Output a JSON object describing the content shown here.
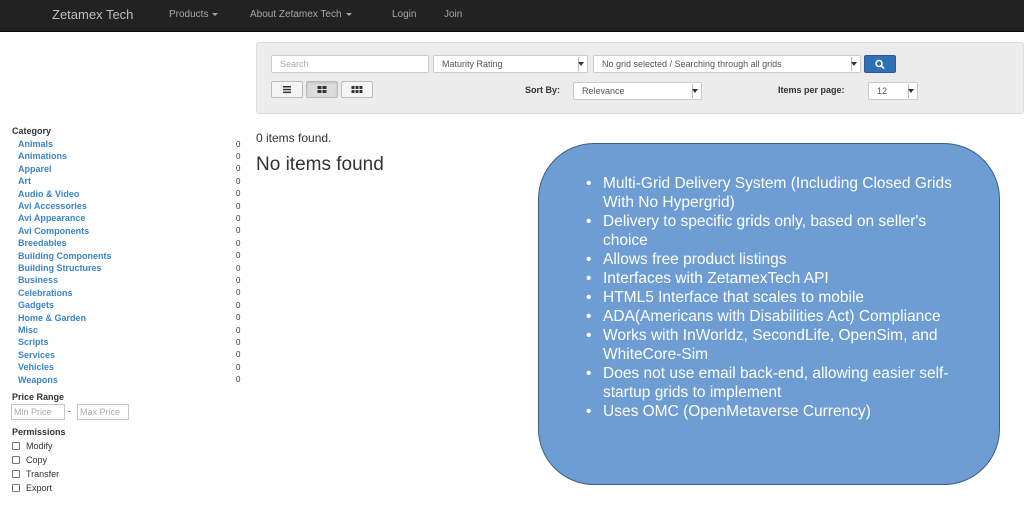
{
  "navbar": {
    "brand": "Zetamex Tech",
    "items": [
      {
        "label": "Products",
        "dropdown": true
      },
      {
        "label": "About Zetamex Tech",
        "dropdown": true
      },
      {
        "label": "Login",
        "dropdown": false
      },
      {
        "label": "Join",
        "dropdown": false
      }
    ]
  },
  "search": {
    "placeholder": "Search",
    "maturity_selected": "Maturity Rating",
    "grid_selected": "No grid selected / Searching through all grids",
    "sort_label": "Sort By:",
    "sort_selected": "Relevance",
    "per_page_label": "Items per page:",
    "per_page_selected": "12"
  },
  "sidebar": {
    "category_heading": "Category",
    "categories": [
      {
        "label": "Animals",
        "count": "0"
      },
      {
        "label": "Animations",
        "count": "0"
      },
      {
        "label": "Apparel",
        "count": "0"
      },
      {
        "label": "Art",
        "count": "0"
      },
      {
        "label": "Audio & Video",
        "count": "0"
      },
      {
        "label": "Avi Accessories",
        "count": "0"
      },
      {
        "label": "Avi Appearance",
        "count": "0"
      },
      {
        "label": "Avi Components",
        "count": "0"
      },
      {
        "label": "Breedables",
        "count": "0"
      },
      {
        "label": "Building Components",
        "count": "0"
      },
      {
        "label": "Building Structures",
        "count": "0"
      },
      {
        "label": "Business",
        "count": "0"
      },
      {
        "label": "Celebrations",
        "count": "0"
      },
      {
        "label": "Gadgets",
        "count": "0"
      },
      {
        "label": "Home & Garden",
        "count": "0"
      },
      {
        "label": "Misc",
        "count": "0"
      },
      {
        "label": "Scripts",
        "count": "0"
      },
      {
        "label": "Services",
        "count": "0"
      },
      {
        "label": "Vehicles",
        "count": "0"
      },
      {
        "label": "Weapons",
        "count": "0"
      }
    ],
    "price_heading": "Price Range",
    "min_price_placeholder": "Min Price",
    "price_separator": "-",
    "max_price_placeholder": "Max Price",
    "permissions_heading": "Permissions",
    "permissions": [
      "Modify",
      "Copy",
      "Transfer",
      "Export"
    ]
  },
  "results": {
    "count_text": "0 items found.",
    "empty_heading": "No items found"
  },
  "callout": {
    "items": [
      "Multi-Grid Delivery System (Including Closed Grids With No Hypergrid)",
      "Delivery to specific grids only, based on seller's choice",
      "Allows free product listings",
      "Interfaces with ZetamexTech API",
      "HTML5 Interface that scales to mobile",
      "ADA(Americans with Disabilities Act) Compliance",
      "Works with InWorldz, SecondLife, OpenSim, and WhiteCore-Sim",
      "Does not use email back-end, allowing easier self-startup grids to implement",
      "Uses OMC (OpenMetaverse Currency)"
    ]
  },
  "colors": {
    "navbar_bg": "#222222",
    "link": "#3a86c8",
    "primary_button": "#2f6fb3",
    "callout_bg": "#6d9dd3"
  }
}
